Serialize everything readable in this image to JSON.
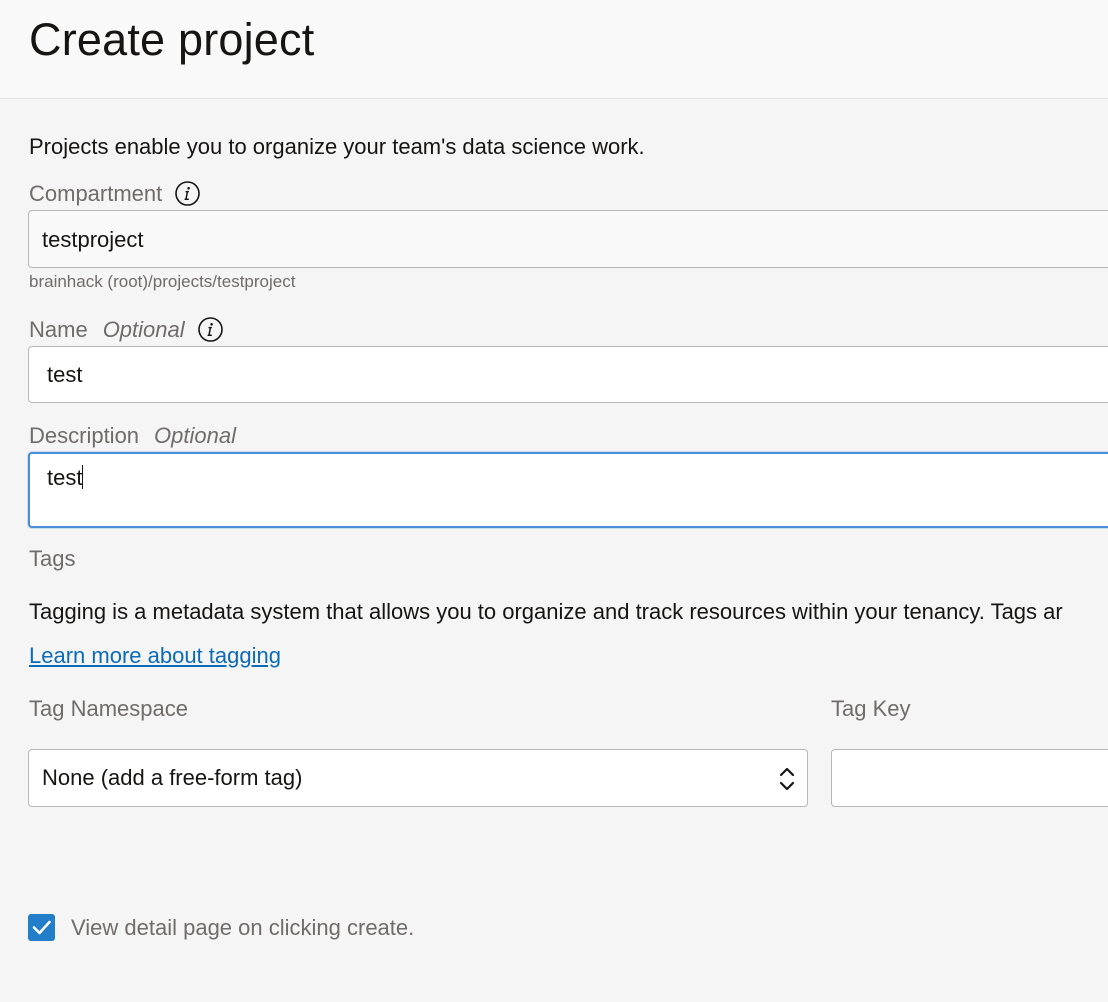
{
  "header": {
    "title": "Create project"
  },
  "intro_text": "Projects enable you to organize your team's data science work.",
  "compartment": {
    "label": "Compartment",
    "value": "testproject",
    "path_hint": "brainhack (root)/projects/testproject"
  },
  "name": {
    "label": "Name",
    "optional": "Optional",
    "value": "test"
  },
  "description": {
    "label": "Description",
    "optional": "Optional",
    "value": "test"
  },
  "tags": {
    "section_label": "Tags",
    "description": "Tagging is a metadata system that allows you to organize and track resources within your tenancy. Tags ar",
    "learn_more_link": "Learn more about tagging",
    "namespace_label": "Tag Namespace",
    "namespace_value": "None (add a free-form tag)",
    "key_label": "Tag Key",
    "key_value": ""
  },
  "view_detail": {
    "label": "View detail page on clicking create.",
    "checked": true
  },
  "colors": {
    "accent": "#227ec8",
    "link": "#0b6bb8",
    "focus_border": "#4a8fd8"
  }
}
